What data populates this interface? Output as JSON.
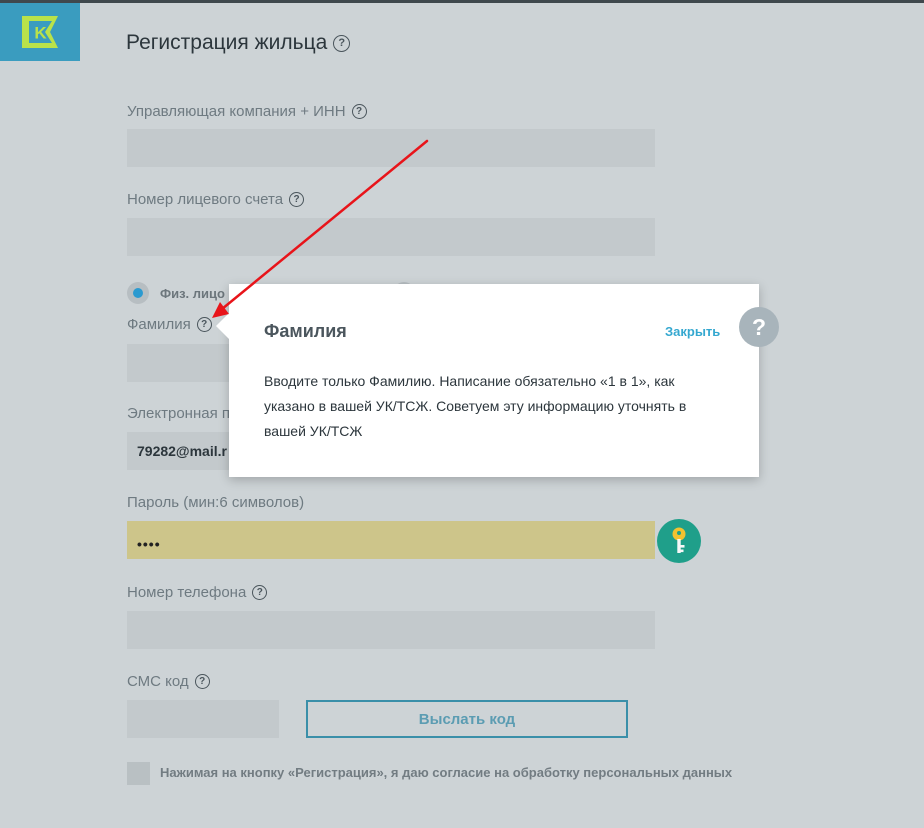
{
  "page": {
    "title": "Регистрация жильца"
  },
  "form": {
    "company_label": "Управляющая компания + ИНН",
    "account_label": "Номер лицевого счета",
    "radio_physical_label": "Физ. лицо",
    "surname_label": "Фамилия",
    "email_label": "Электронная п",
    "email_value": "79282@mail.r",
    "password_label": "Пароль (мин:6 символов)",
    "password_value": "••••",
    "phone_label": "Номер телефона",
    "sms_label": "СМС код",
    "send_code_label": "Выслать код",
    "consent_text": "Нажимая на кнопку «Регистрация», я даю согласие на обработку персональных данных"
  },
  "popup": {
    "title": "Фамилия",
    "close_label": "Закрыть",
    "body": "Вводите только Фамилию. Написание обязательно «1 в 1», как указано в вашей УК/ТСЖ. Советуем эту информацию уточнять в вашей УК/ТСЖ",
    "help_glyph": "?"
  },
  "help_glyph": "?",
  "logo_letter": "K",
  "icons": {
    "logo": "kvartplata-logo-icon",
    "help": "question-circle-icon",
    "key": "key-icon",
    "arrow": "red-annotation-arrow"
  },
  "colors": {
    "accent": "#3a9cbf",
    "link": "#35a8d0",
    "key_button": "#1f9f8a",
    "password_fill": "#cdc58a",
    "arrow": "#e8141a"
  }
}
